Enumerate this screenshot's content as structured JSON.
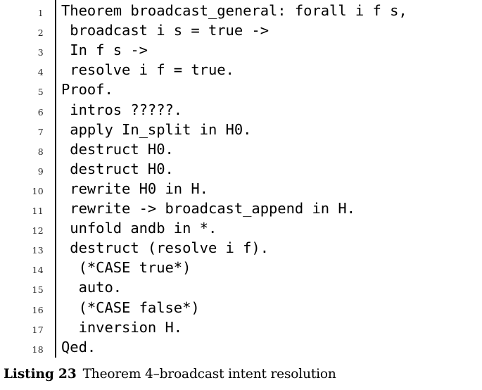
{
  "listing": {
    "language": "Coq",
    "gutter_rule_color": "#1a1a1a",
    "line_number_color": "#2b2b2b",
    "code_color": "#000000",
    "background_color": "#ffffff",
    "lines": [
      {
        "n": "1",
        "code": "Theorem broadcast_general: forall i f s,"
      },
      {
        "n": "2",
        "code": " broadcast i s = true ->"
      },
      {
        "n": "3",
        "code": " In f s ->"
      },
      {
        "n": "4",
        "code": " resolve i f = true."
      },
      {
        "n": "5",
        "code": "Proof."
      },
      {
        "n": "6",
        "code": " intros ?????."
      },
      {
        "n": "7",
        "code": " apply In_split in H0."
      },
      {
        "n": "8",
        "code": " destruct H0."
      },
      {
        "n": "9",
        "code": " destruct H0."
      },
      {
        "n": "10",
        "code": " rewrite H0 in H."
      },
      {
        "n": "11",
        "code": " rewrite -> broadcast_append in H."
      },
      {
        "n": "12",
        "code": " unfold andb in *."
      },
      {
        "n": "13",
        "code": " destruct (resolve i f)."
      },
      {
        "n": "14",
        "code": "  (*CASE true*)"
      },
      {
        "n": "15",
        "code": "  auto."
      },
      {
        "n": "16",
        "code": "  (*CASE false*)"
      },
      {
        "n": "17",
        "code": "  inversion H."
      },
      {
        "n": "18",
        "code": "Qed."
      }
    ]
  },
  "caption": {
    "label": "Listing 23",
    "text": "Theorem 4–broadcast intent resolution"
  }
}
